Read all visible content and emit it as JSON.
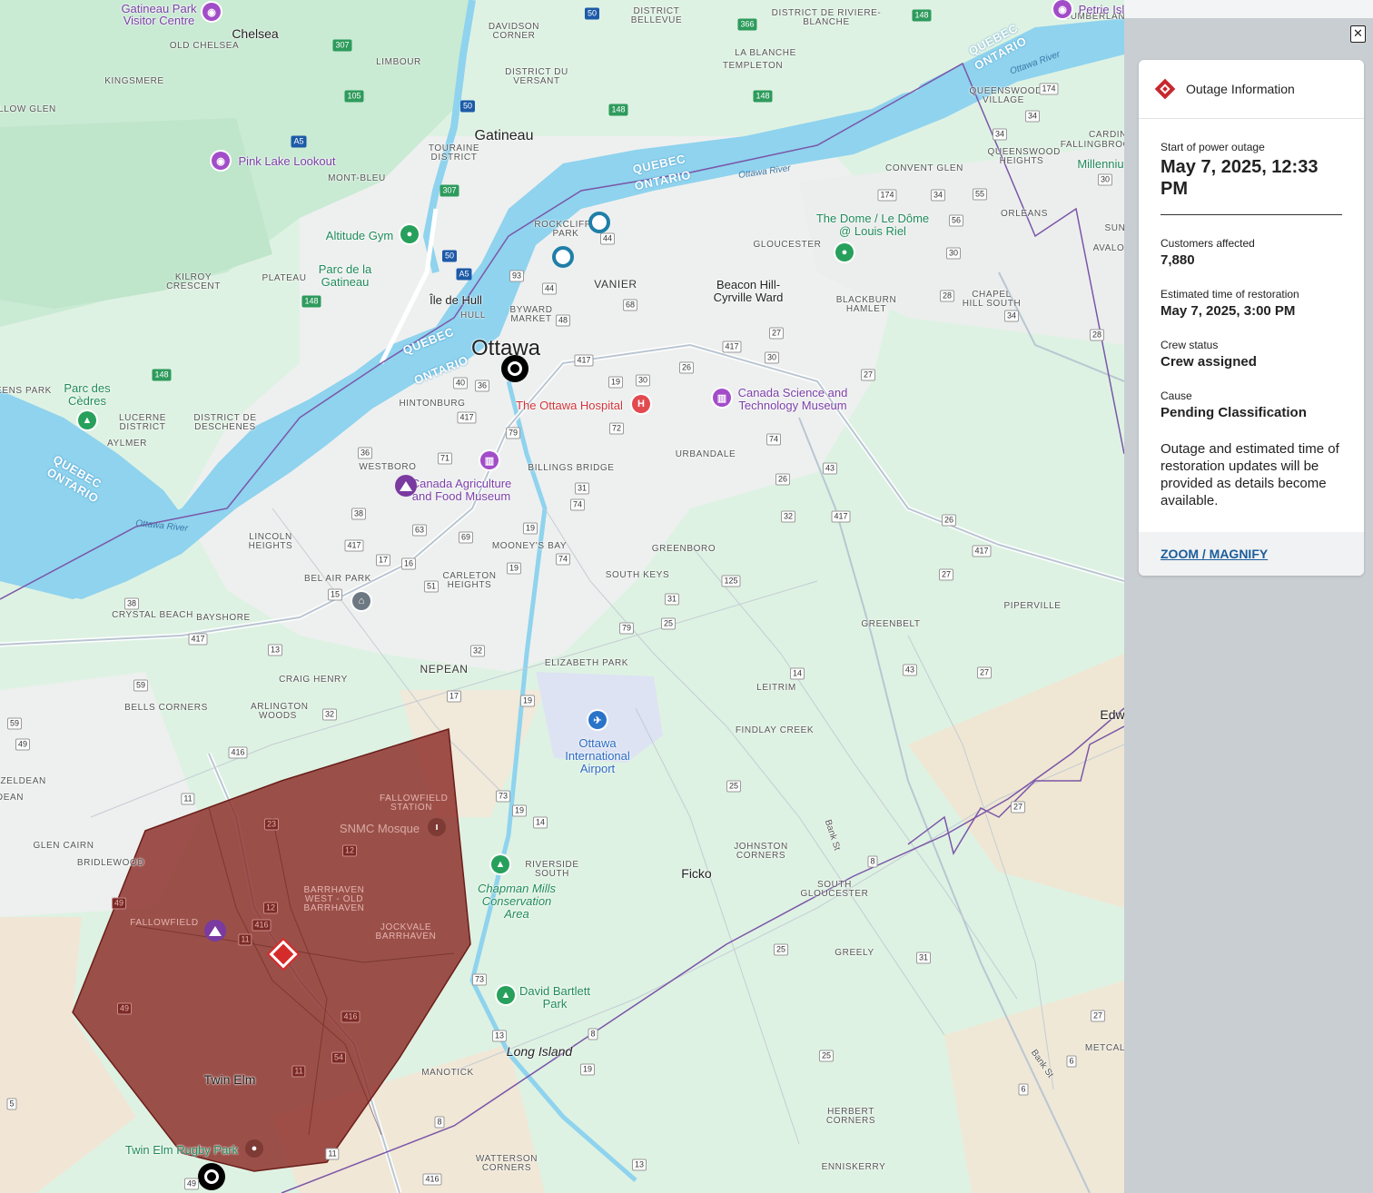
{
  "panel": {
    "close_icon": "close-icon",
    "title": "Outage Information",
    "icon": "outage-diamond-icon",
    "start_label": "Start of power outage",
    "start_value": "May 7, 2025, 12:33 PM",
    "customers_label": "Customers affected",
    "customers_value": "7,880",
    "etr_label": "Estimated time of restoration",
    "etr_value": "May 7, 2025, 3:00 PM",
    "crew_label": "Crew status",
    "crew_value": "Crew assigned",
    "cause_label": "Cause",
    "cause_value": "Pending Classification",
    "note": "Outage and estimated time of restoration updates will be provided as details become available.",
    "zoom_link": "ZOOM / MAGNIFY"
  },
  "map": {
    "outage_color": "#8b2c27",
    "places": {
      "ottawa": "Ottawa",
      "gatineau": "Gatineau",
      "chelsea": "Chelsea",
      "nepean": "NEPEAN",
      "vanier": "VANIER",
      "beacon": "Beacon Hill-Cyrville Ward",
      "ficko": "Ficko",
      "twin_elm": "Twin Elm",
      "long_island": "Long Island",
      "ile_de_hull": "Île de Hull",
      "orleans": "ORLEANS",
      "edw": "Edw"
    },
    "pois": {
      "pink_lake": "Pink Lake Lookout",
      "gatineau_park": "Gatineau Park Visitor Centre",
      "petrie": "Petrie Island Beach",
      "altitude": "Altitude Gym",
      "parc_gatineau": "Parc de la Gatineau",
      "parc_cedres": "Parc des Cèdres",
      "hospital": "The Ottawa Hospital",
      "science": "Canada Science and Technology Museum",
      "agri": "Canada Agriculture and Food Museum",
      "dome": "The Dome / Le Dôme @ Louis Riel",
      "airport": "Ottawa International Airport",
      "mosque": "SNMC Mosque",
      "chapman": "Chapman Mills Conservation Area",
      "david": "David Bartlett Park",
      "rugby": "Twin Elm Rugby Park"
    },
    "districts": {
      "fallowfield_station": "FALLOWFIELD STATION",
      "barrhaven_west": "BARRHAVEN WEST - OLD BARRHAVEN",
      "jockvale": "JOCKVALE BARRHAVEN",
      "fallowfield": "FALLOWFIELD",
      "riverside": "RIVERSIDE SOUTH",
      "manotick": "MANOTICK",
      "watterson": "WATTERSON CORNERS",
      "johnston": "JOHNSTON CORNERS",
      "south_gloucester": "SOUTH GLOUCESTER",
      "greely": "GREELY",
      "herbert": "HERBERT CORNERS",
      "enniskerry": "ENNISKERRY",
      "metcalfe": "METCAL",
      "leitrim": "LEITRIM",
      "findlay": "FINDLAY CREEK",
      "greenbelt": "GREENBELT",
      "piperville": "PIPERVILLE",
      "elizabeth": "ELIZABETH PARK",
      "south_keys": "SOUTH KEYS",
      "greenboro": "GREENBORO",
      "mooneys": "MOONEY'S BAY",
      "carleton": "CARLETON HEIGHTS",
      "bel_air": "BEL AIR PARK",
      "lincoln": "LINCOLN HEIGHTS",
      "crystal": "CRYSTAL BEACH",
      "bayshore": "BAYSHORE",
      "craig": "CRAIG HENRY",
      "bells": "BELLS CORNERS",
      "arlington": "ARLINGTON WOODS",
      "glen_cairn": "GLEN CAIRN",
      "bridlewood": "BRIDLEWOOD",
      "westboro": "WESTBORO",
      "billings": "BILLINGS BRIDGE",
      "urbandale": "URBANDALE",
      "hintonburg": "HINTONBURG",
      "byward": "BYWARD MARKET",
      "hull": "HULL",
      "lucerne": "LUCERNE DISTRICT",
      "deschenes": "DISTRICT DE DESCHENES",
      "aylmer": "AYLMER",
      "kilroy": "KILROY CRESCENT",
      "plateau": "PLATEAU",
      "mont_bleu": "MONT-BLEU",
      "touraine": "TOURAINE DISTRICT",
      "limbour": "LIMBOUR",
      "kingsmere": "KINGSMERE",
      "old_chelsea": "OLD CHELSEA",
      "davidson": "DAVIDSON CORNER",
      "versant": "DISTRICT DU VERSANT",
      "bellevue": "DISTRICT BELLEVUE",
      "riviere": "DISTRICT DE RIVIERE-BLANCHE",
      "la_blanche": "LA BLANCHE",
      "templeton": "TEMPLETON",
      "convent": "CONVENT GLEN",
      "gloucester": "GLOUCESTER",
      "blackburn": "BLACKBURN HAMLET",
      "chapel": "CHAPEL HILL SOUTH",
      "queenswood": "QUEENSWOOD HEIGHTS",
      "queenswood_v": "QUEENSWOOD VILLAGE",
      "fallingbrook": "FALLINGBROOK",
      "cardin": "CARDIN",
      "millennium": "Millenniu",
      "rockcliffe": "ROCKCLIFFE PARK",
      "eens": "EENS PARK",
      "llow": "LLOW GLEN",
      "azel": "AZELDEAN",
      "dean": "DEAN",
      "avalo": "AVALO",
      "sun": "SUN",
      "cumberl": "CUMBERLAN"
    },
    "province": {
      "quebec": "QUEBEC",
      "ontario": "ONTARIO"
    },
    "water": {
      "ottawa_river": "Ottawa River"
    },
    "roads": {
      "bank_st": "Bank St"
    }
  }
}
